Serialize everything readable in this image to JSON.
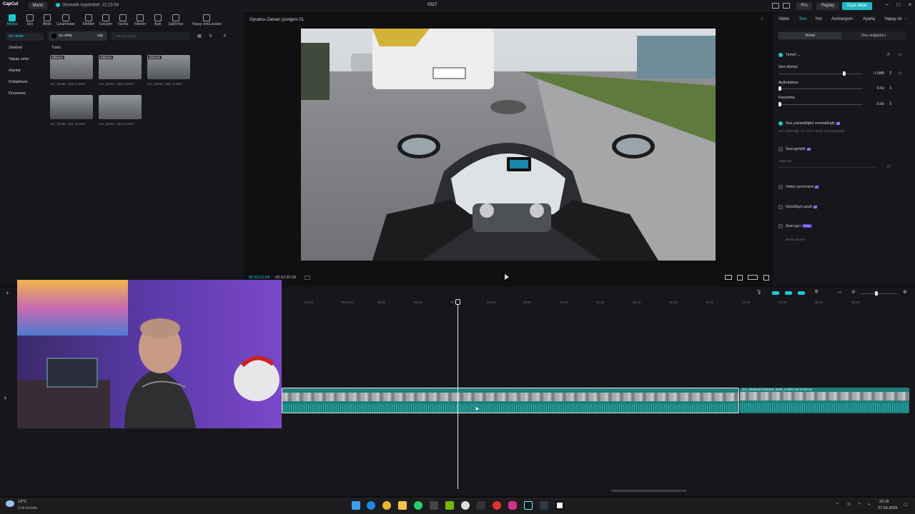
{
  "app": {
    "logo": "CapCut",
    "menu_label": "Menü",
    "autosave_text": "Otomatik kaydedildi: 22:15:58",
    "window_title": "0327",
    "pro_label": "Pro",
    "share_label": "Paylaş",
    "export_label": "Dışa Aktar"
  },
  "tools": [
    {
      "label": "Medya",
      "icon": "media-icon",
      "active": true
    },
    {
      "label": "Ses",
      "icon": "audio-icon"
    },
    {
      "label": "Metin",
      "icon": "text-icon"
    },
    {
      "label": "Çıkartmalar",
      "icon": "sticker-icon"
    },
    {
      "label": "Efektler",
      "icon": "effects-icon"
    },
    {
      "label": "Geçişler",
      "icon": "transitions-icon"
    },
    {
      "label": "Yazılar",
      "icon": "captions-icon"
    },
    {
      "label": "Filtreler",
      "icon": "filters-icon"
    },
    {
      "label": "Ayar",
      "icon": "adjust-icon"
    },
    {
      "label": "Şablonlar",
      "icon": "templates-icon"
    },
    {
      "label": "Yapay zekâ avatar",
      "icon": "ai-avatar-icon"
    }
  ],
  "media": {
    "sidebar": [
      {
        "label": "İçe aktar",
        "selected": true
      },
      {
        "label": "Stokİnd"
      },
      {
        "label": "Yapay zeka"
      },
      {
        "label": "Alanlar"
      },
      {
        "label": "Kütüphane"
      },
      {
        "label": "Dreamina"
      }
    ],
    "import_label": "İçe aktar",
    "record_label": "yap",
    "search_placeholder": "Medya arayın",
    "filter_label": "Tümü",
    "clips": [
      {
        "tag": "Eklendi",
        "name": "DJI_20260...058_D.MP4"
      },
      {
        "tag": "Eklendi",
        "name": "DJI_20260...059_D.MP4"
      },
      {
        "tag": "Eklendi",
        "name": "DJI_20260...060_D.MP4"
      },
      {
        "tag": "",
        "name": "DJI_20260...061_D.MP4"
      },
      {
        "tag": "",
        "name": "DJI_20260...062_D.MP4"
      }
    ]
  },
  "player": {
    "title": "Oynatıcı-Zaman çizelgesi 01",
    "current_time": "00:30:21:54",
    "total_time": "00:42:30:28"
  },
  "inspector": {
    "tabs": [
      "Video",
      "Ses",
      "Hız",
      "Animasyon",
      "Ayarla",
      "Yapay ze"
    ],
    "selected_tab": "Ses",
    "sub_tabs": [
      "Temel",
      "Ses değiştirici"
    ],
    "basic_label": "Temel",
    "volume_label": "Ses düzeyi",
    "volume_value": "-1.0dB",
    "volume_level": 0.78,
    "fadein_label": "Aydınlatma",
    "fadein_value": "0.0s",
    "fadeout_label": "Karartma",
    "fadeout_value": "0.0s",
    "normalize_label": "Ses yüksekliğini normalleştir",
    "normalize_desc": "Ses yüksekliği -23 LUFS olarak normalleştirildi",
    "enhance_label": "Sesi geliştir",
    "enhance_sub": "Yoğunluk",
    "enhance_value": "25",
    "translate_label": "Video çevirmeni",
    "noise_label": "Gürültüyü azalt",
    "separate_label": "Sesi ayır",
    "separate_badge": "Free",
    "beat_label": "Ritmik düzele"
  },
  "timeline": {
    "ruler_ticks": [
      "00:4:0",
      "00:50:00",
      "00:00",
      "00:50",
      "00:30",
      "00:4:0",
      "00:50",
      "01:00",
      "01:10",
      "01:20",
      "01:30",
      "01:40",
      "01:50",
      "02:00",
      "02:10",
      "02:20"
    ],
    "clip_b_label": "DJI_20260327165338_0060_D.MP4   00:10:52:13"
  },
  "taskbar": {
    "weather_temp": "13°C",
    "weather_desc": "Çok bulutlu",
    "time": "22:16",
    "date": "27.03.2026"
  }
}
